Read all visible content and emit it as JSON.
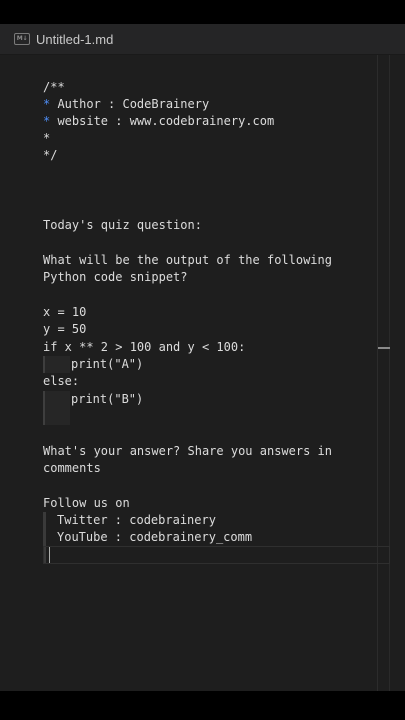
{
  "tab": {
    "icon": "markdown-file-icon",
    "icon_text": "M↓",
    "title": "Untitled-1.md"
  },
  "colors": {
    "background": "#1e1e1e",
    "text": "#dcdcdc",
    "bullet": "#4f8ef7"
  },
  "doc": {
    "comment_open": "/**",
    "author_star": "*",
    "author_text": " Author : CodeBrainery",
    "website_star": "*",
    "website_text": " website : www.codebrainery.com",
    "empty_star": "*",
    "comment_close": "*/",
    "quiz_heading": "Today's quiz question:",
    "question_line1": "What will be the output of the following",
    "question_line2": "Python code snippet?",
    "code_x": "x = 10",
    "code_y": "y = 50",
    "code_if": "if x ** 2 > 100 and y < 100:",
    "code_print_a": "print(\"A\")",
    "code_else": "else:",
    "code_print_b": "print(\"B\")",
    "answer_line1": "What's your answer? Share you answers in",
    "answer_line2": "comments",
    "follow": "Follow us on",
    "twitter": "Twitter : codebrainery",
    "youtube": "YouTube : codebrainery_comm"
  }
}
